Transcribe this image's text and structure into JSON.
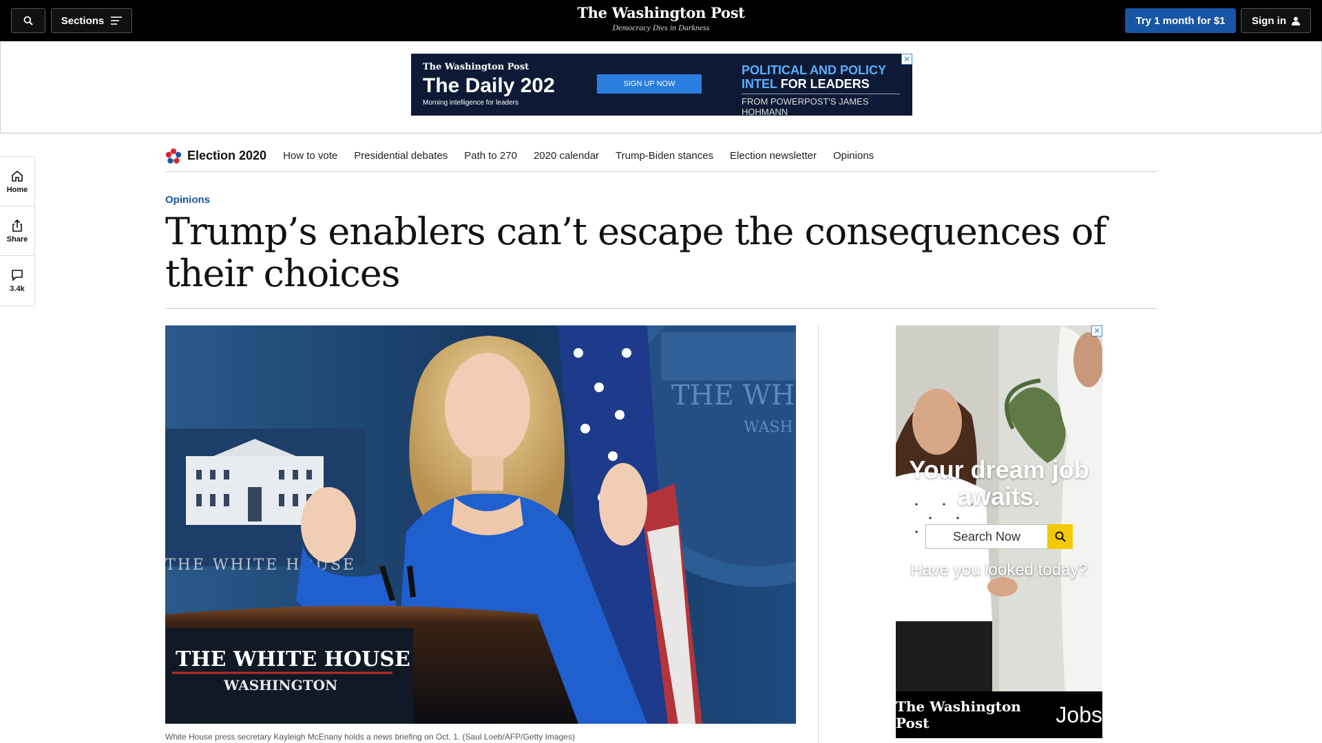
{
  "header": {
    "sections_label": "Sections",
    "logo": "The Washington Post",
    "tagline": "Democracy Dies in Darkness",
    "subscribe_label": "Try 1 month for $1",
    "signin_label": "Sign in"
  },
  "top_ad": {
    "brand": "The Washington Post",
    "title": "The Daily 202",
    "subtitle": "Morning intelligence for leaders",
    "cta": "SIGN UP NOW",
    "headline_blue": "POLITICAL AND POLICY INTEL",
    "headline_white": "FOR LEADERS",
    "footer": "FROM POWERPOST'S JAMES HOHMANN"
  },
  "rail": {
    "home": "Home",
    "share": "Share",
    "comments": "3.4k"
  },
  "election_nav": {
    "brand": "Election 2020",
    "links": [
      "How to vote",
      "Presidential debates",
      "Path to 270",
      "2020 calendar",
      "Trump-Biden stances",
      "Election newsletter",
      "Opinions"
    ]
  },
  "article": {
    "kicker": "Opinions",
    "headline": "Trump’s enablers can’t escape the consequences of their choices",
    "caption": "White House press secretary Kayleigh McEnany holds a news briefing on Oct. 1. (Saul Loeb/AFP/Getty Images)",
    "photo_podium_text": "THE WHITE HOUSE",
    "photo_podium_sub": "WASHINGTON",
    "photo_wall_text": "THE WHITE HOUSE",
    "photo_seal_text": "THE WH",
    "photo_seal_sub": "WASH"
  },
  "side_ad": {
    "headline": "Your dream job awaits.",
    "search_placeholder": "Search Now",
    "question": "Have you looked today?",
    "footer_brand": "The Washington Post",
    "footer_product": "Jobs"
  },
  "colors": {
    "accent_blue": "#1955a5",
    "topbar": "#000000",
    "ad_navy": "#0e1a35"
  }
}
